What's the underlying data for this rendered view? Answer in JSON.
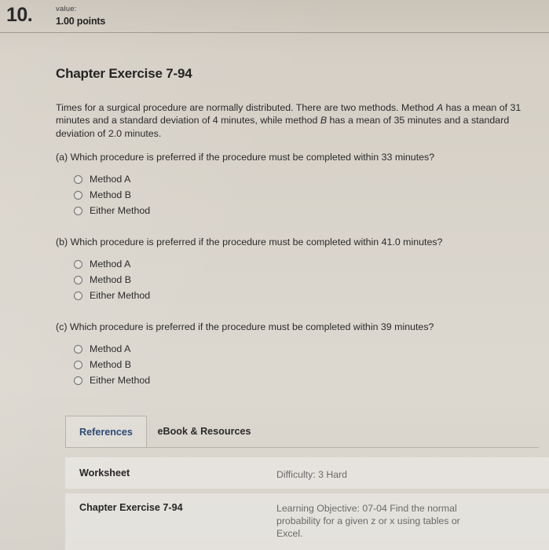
{
  "header": {
    "question_number": "10.",
    "value_label": "value:",
    "points": "1.00 points"
  },
  "exercise": {
    "title": "Chapter Exercise 7-94",
    "intro_1": "Times for a surgical procedure are normally distributed. There are two methods. Method ",
    "intro_method_a": "A",
    "intro_2": " has a mean of 31 minutes and a standard deviation of 4 minutes, while method ",
    "intro_method_b": "B",
    "intro_3": " has a mean of 35 minutes and a standard deviation of 2.0 minutes."
  },
  "parts": [
    {
      "label": "(a)",
      "question": "Which procedure is preferred if the procedure must be completed within 33 minutes?",
      "options": [
        {
          "label": "Method A",
          "selected": false
        },
        {
          "label": "Method B",
          "selected": false
        },
        {
          "label": "Either Method",
          "selected": false
        }
      ]
    },
    {
      "label": "(b)",
      "question": "Which procedure is preferred if the procedure must be completed within 41.0 minutes?",
      "options": [
        {
          "label": "Method A",
          "selected": false
        },
        {
          "label": "Method B",
          "selected": false
        },
        {
          "label": "Either Method",
          "selected": false
        }
      ]
    },
    {
      "label": "(c)",
      "question": "Which procedure is preferred if the procedure must be completed within 39 minutes?",
      "options": [
        {
          "label": "Method A",
          "selected": false
        },
        {
          "label": "Method B",
          "selected": false
        },
        {
          "label": "Either Method",
          "selected": false
        }
      ]
    }
  ],
  "tabs": [
    {
      "label": "References",
      "active": true
    },
    {
      "label": "eBook & Resources",
      "active": false
    }
  ],
  "footer_rows": [
    {
      "title": "Worksheet",
      "meta": "Difficulty: 3 Hard"
    },
    {
      "title": "Chapter Exercise 7-94",
      "meta": "Learning Objective: 07-04 Find the normal probability for a given z or x using tables or Excel."
    }
  ],
  "colors": {
    "page_background": "#d8d3ca",
    "text": "#2b2b2b",
    "active_tab_text": "#2d4a77",
    "meta_text": "#6a6a6a",
    "row_background": "#e3dfd8"
  }
}
